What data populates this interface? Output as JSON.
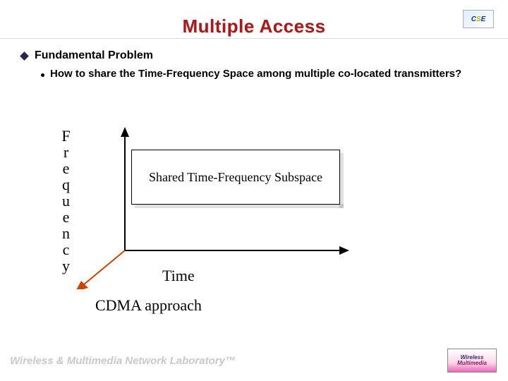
{
  "title": "Multiple Access",
  "logo_top": {
    "c": "C",
    "s": "S",
    "e": "E"
  },
  "bullet1": "Fundamental Problem",
  "bullet2": "How to share the Time-Frequency Space among multiple co-located transmitters?",
  "y_axis": "Frequency",
  "x_axis": "Time",
  "shared_box": "Shared Time-Frequency Subspace",
  "approach": "CDMA approach",
  "footer": "Wireless & Multimedia Network Laboratory™",
  "logo_bottom": {
    "l1": "Wireless",
    "l2": "Multimedia"
  }
}
